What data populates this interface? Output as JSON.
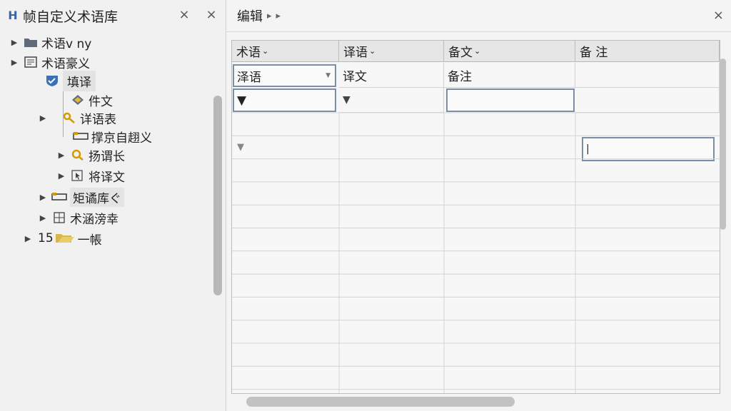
{
  "left_panel": {
    "title": "帧自定义术语库",
    "tree": {
      "items": [
        {
          "label": "术语v ny",
          "icon": "folder-icon"
        },
        {
          "label": "术语豪义",
          "icon": "document-list-icon"
        },
        {
          "label": "填译",
          "icon": "check-shield-icon"
        },
        {
          "label": "件文",
          "icon": "diamond-tag-icon"
        },
        {
          "label": "详语表",
          "icon": "key-icon"
        },
        {
          "label": "撑京自趐义",
          "icon": "bookmark-tag-icon"
        },
        {
          "label": "扬谓长",
          "icon": "search-icon"
        },
        {
          "label": "将译文",
          "icon": "cursor-page-icon"
        },
        {
          "label": "矩谲库ぐ",
          "icon": "bookmark-tag-icon"
        },
        {
          "label": "术涵滂幸",
          "icon": "grid-doc-icon"
        },
        {
          "label": "一帳",
          "icon": "folder-open-icon",
          "prefix": "15"
        }
      ]
    }
  },
  "right_panel": {
    "breadcrumb": "编辑",
    "grid": {
      "columns": [
        {
          "label": "术语",
          "caret": "⌄"
        },
        {
          "label": "译语",
          "caret": "⌄"
        },
        {
          "label": "备文",
          "caret": "⌄"
        },
        {
          "label": "备 注",
          "caret": ""
        }
      ],
      "row1": [
        "泽语",
        "译文",
        "备注",
        ""
      ]
    }
  },
  "icons": {
    "close": "×",
    "breadcrumb_arrow": "▸",
    "tree_expand": "▶",
    "cell_marker": "▼"
  },
  "colors": {
    "accent": "#3b63a3",
    "folder": "#5f6b7a",
    "key": "#d49a00",
    "edit_border": "#7b8ea6"
  }
}
